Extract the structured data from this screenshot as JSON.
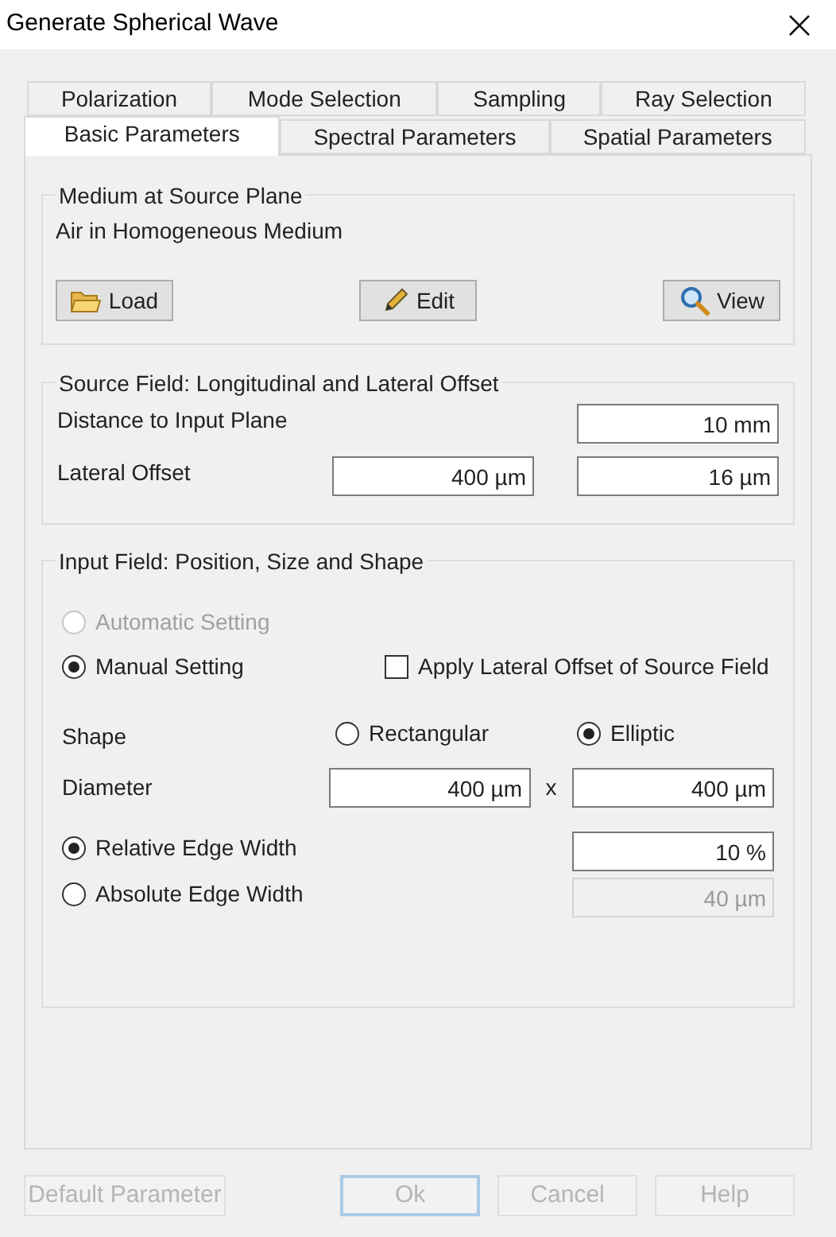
{
  "window": {
    "title": "Generate Spherical Wave"
  },
  "tab_rows": [
    [
      {
        "label": "Polarization",
        "selected": false
      },
      {
        "label": "Mode Selection",
        "selected": false
      },
      {
        "label": "Sampling",
        "selected": false
      },
      {
        "label": "Ray Selection",
        "selected": false
      }
    ],
    [
      {
        "label": "Basic Parameters",
        "selected": true
      },
      {
        "label": "Spectral Parameters",
        "selected": false
      },
      {
        "label": "Spatial Parameters",
        "selected": false
      }
    ]
  ],
  "medium": {
    "title": "Medium at Source Plane",
    "description": "Air in Homogeneous Medium",
    "buttons": [
      {
        "kind": "folder",
        "label": "Load"
      },
      {
        "kind": "pencil",
        "label": "Edit"
      },
      {
        "kind": "magnifier",
        "label": "View"
      }
    ]
  },
  "source_field": {
    "title": "Source Field: Longitudinal and Lateral Offset",
    "distance_label": "Distance to Input Plane",
    "distance": "10 mm",
    "offset_label": "Lateral Offset",
    "offset_x": "400 µm",
    "offset_y": "16 µm"
  },
  "input_field": {
    "title": "Input Field: Position, Size and Shape",
    "setting_modes": [
      {
        "label": "Automatic Setting",
        "selected": false,
        "disabled": true
      },
      {
        "label": "Manual Setting",
        "selected": true,
        "disabled": false
      }
    ],
    "apply_offset": {
      "label": "Apply Lateral Offset of Source Field",
      "checked": false
    },
    "shape_label": "Shape",
    "shapes": [
      {
        "label": "Rectangular",
        "selected": false
      },
      {
        "label": "Elliptic",
        "selected": true
      }
    ],
    "diameter_label": "Diameter",
    "diameter_x": "400 µm",
    "separator": "x",
    "diameter_y": "400 µm",
    "edge_modes": [
      {
        "label": "Relative Edge Width",
        "selected": true,
        "value": "10 %",
        "disabled": false
      },
      {
        "label": "Absolute Edge Width",
        "selected": false,
        "value": "40 µm",
        "disabled": true
      }
    ]
  },
  "footer_buttons": [
    {
      "label": "Default Parameter",
      "disabled": true,
      "focused": false
    },
    {
      "label": "Ok",
      "disabled": true,
      "focused": true
    },
    {
      "label": "Cancel",
      "disabled": true,
      "focused": false
    },
    {
      "label": "Help",
      "disabled": true,
      "focused": false
    }
  ]
}
